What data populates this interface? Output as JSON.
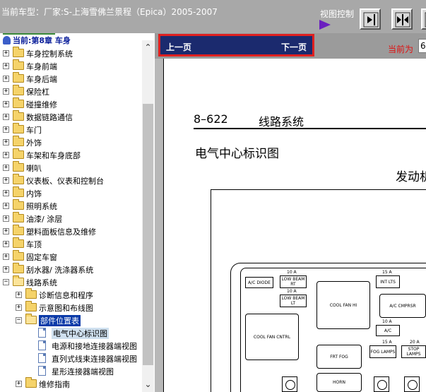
{
  "header": {
    "title": "当前车型：厂家:S-上海雪佛兰景程（Epica）2005-2007",
    "view_control_label": "视图控制"
  },
  "view_buttons": [
    {
      "name": "collapse-left-button",
      "icon": "collapse-left-icon"
    },
    {
      "name": "split-view-button",
      "icon": "split-view-icon"
    },
    {
      "name": "expand-right-button",
      "icon": "expand-right-icon"
    }
  ],
  "tree": {
    "current_label": "当前:第8章 车身",
    "items": [
      {
        "label": "车身控制系统",
        "level": 0,
        "type": "folder",
        "expander": "+"
      },
      {
        "label": "车身前端",
        "level": 0,
        "type": "folder",
        "expander": "+"
      },
      {
        "label": "车身后端",
        "level": 0,
        "type": "folder",
        "expander": "+"
      },
      {
        "label": "保险杠",
        "level": 0,
        "type": "folder",
        "expander": "+"
      },
      {
        "label": "碰撞维修",
        "level": 0,
        "type": "folder",
        "expander": "+"
      },
      {
        "label": "数据链路通信",
        "level": 0,
        "type": "folder",
        "expander": "+"
      },
      {
        "label": "车门",
        "level": 0,
        "type": "folder",
        "expander": "+"
      },
      {
        "label": "外饰",
        "level": 0,
        "type": "folder",
        "expander": "+"
      },
      {
        "label": "车架和车身底部",
        "level": 0,
        "type": "folder",
        "expander": "+"
      },
      {
        "label": "喇叭",
        "level": 0,
        "type": "folder",
        "expander": "+"
      },
      {
        "label": "仪表板、仪表和控制台",
        "level": 0,
        "type": "folder",
        "expander": "+"
      },
      {
        "label": "内饰",
        "level": 0,
        "type": "folder",
        "expander": "+"
      },
      {
        "label": "照明系统",
        "level": 0,
        "type": "folder",
        "expander": "+"
      },
      {
        "label": "油漆/ 涂层",
        "level": 0,
        "type": "folder",
        "expander": "+"
      },
      {
        "label": "塑料面板信息及维修",
        "level": 0,
        "type": "folder",
        "expander": "+"
      },
      {
        "label": "车顶",
        "level": 0,
        "type": "folder",
        "expander": "+"
      },
      {
        "label": "固定车窗",
        "level": 0,
        "type": "folder",
        "expander": "+"
      },
      {
        "label": "刮水器/ 洗涤器系统",
        "level": 0,
        "type": "folder",
        "expander": "+"
      },
      {
        "label": "线路系统",
        "level": 0,
        "type": "folder-open",
        "expander": "−"
      },
      {
        "label": "诊断信息和程序",
        "level": 1,
        "type": "folder",
        "expander": "+"
      },
      {
        "label": "示意图和布线图",
        "level": 1,
        "type": "folder",
        "expander": "+"
      },
      {
        "label": "部件位置表",
        "level": 1,
        "type": "folder-open",
        "expander": "−",
        "state": "selected"
      },
      {
        "label": "电气中心标识图",
        "level": 2,
        "type": "page",
        "state": "highlighted"
      },
      {
        "label": "电源和接地连接器端视图",
        "level": 2,
        "type": "page"
      },
      {
        "label": "直列式线束连接器端视图",
        "level": 2,
        "type": "page"
      },
      {
        "label": "星形连接器端视图",
        "level": 2,
        "type": "page"
      },
      {
        "label": "维修指南",
        "level": 1,
        "type": "folder",
        "expander": "+"
      }
    ]
  },
  "nav": {
    "prev_label": "上一页",
    "next_label": "下一页",
    "current_page_label": "当前为",
    "current_page_value": "6"
  },
  "document": {
    "page_number": "8–622",
    "section_title": "线路系统",
    "heading": "电气中心标识图",
    "subheading": "发动机"
  },
  "diagram": {
    "fuses": [
      {
        "label": "A/C DIODE"
      },
      {
        "amp": "10 A",
        "label": "LOW BEAM RT"
      },
      {
        "amp": "10 A",
        "label": "LOW BEAM LT"
      },
      {
        "amp": "15 A",
        "label": "INT LTS"
      },
      {
        "label": "COOL FAN HI"
      },
      {
        "label": "A/C CMPRSR"
      },
      {
        "amp": "10 A",
        "label": "A/C"
      },
      {
        "label": "COOL FAN CNTRL"
      },
      {
        "label": "FRT FOG"
      },
      {
        "amp": "15 A",
        "label": "FOG LAMPS"
      },
      {
        "amp": "20 A",
        "label": "STOP LAMPS"
      },
      {
        "label": "HORN"
      }
    ]
  }
}
